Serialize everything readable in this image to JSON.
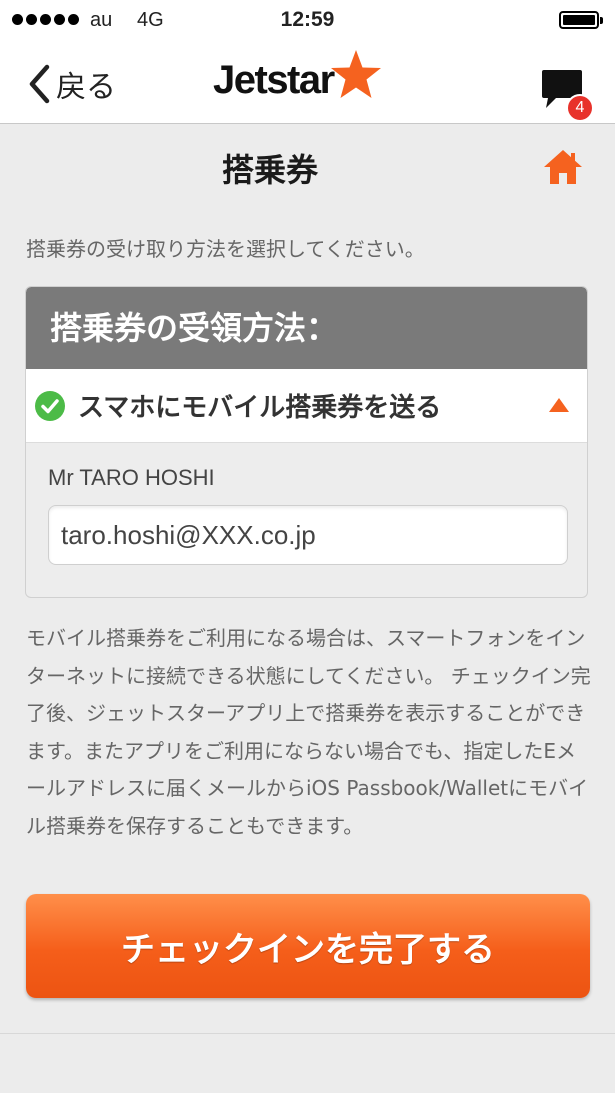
{
  "status_bar": {
    "carrier": "au",
    "network": "4G",
    "time": "12:59"
  },
  "nav": {
    "back_label": "戻る",
    "logo_text": "Jetstar",
    "notification_count": "4"
  },
  "page": {
    "title": "搭乗券",
    "instruction": "搭乗券の受け取り方法を選択してください。"
  },
  "receipt_card": {
    "header": "搭乗券の受領方法：",
    "selected_option": "スマホにモバイル搭乗券を送る",
    "passenger_name": "Mr TARO HOSHI",
    "email_value": "taro.hoshi@XXX.co.jp"
  },
  "note": "モバイル搭乗券をご利用になる場合は、スマートフォンをインターネットに接続できる状態にしてください。 チェックイン完了後、ジェットスターアプリ上で搭乗券を表示することができます。またアプリをご利用にならない場合でも、指定したEメールアドレスに届くメールからiOS Passbook/Walletにモバイル搭乗券を保存することもできます。",
  "actions": {
    "complete_checkin": "チェックインを完了する"
  },
  "colors": {
    "brand_orange": "#f5621f",
    "header_gray": "#7a7a7a",
    "check_green": "#4cbb47",
    "badge_red": "#e8322b"
  },
  "icons": {
    "back": "chevron-left-icon",
    "logo_star": "star-icon",
    "chat": "chat-bubble-icon",
    "home": "home-icon",
    "selected": "check-circle-icon",
    "expand": "caret-up-icon"
  }
}
